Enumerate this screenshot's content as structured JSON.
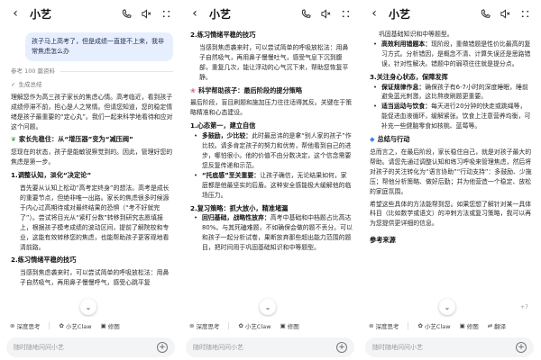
{
  "app": {
    "title": "小艺",
    "toolbar": [
      "深度思考",
      "小艺Claw",
      "修图",
      "翻译"
    ],
    "input_placeholder": "随时随地问问小艺"
  },
  "panel1": {
    "user_message": "孩子马上高考了，但是成绩一直提不上来，我非常焦虑怎么办",
    "ref_label": "参考 100 篇资料",
    "thinking_label": "生成总结",
    "intro": "理解您作为高三孩子家长的焦虑心情。高考临近，看到孩子成绩停滞不前，担心是人之常情。但请您知道，您的稳定情绪是孩子最重要的“定心丸”。我们一起来科学地看待和应对这个问题。",
    "section_title": "家长先稳住：从“增压器”变为“减压阀”",
    "section_intro": "您现在的状态，孩子是能敏锐察觉到的。因此，管理好您的焦虑是第一步。",
    "h1": "1.调整认知，淡化“决定论”",
    "h1_body": "首先要从认知上松动“高考定终身”的想法。高考是成长的重要节点，但绝非唯一出路。家长的焦虑很多时候源于内心过高期待或对最终结果的恐惧（“考不好就完了”）。尝试将目光从“紧盯分数”转移到研究志愿填报上，根据孩子模考成绩的波动区间，提前了解院校和专业，这能有效转移您的焦虑，也能帮助孩子更客观地看清前路。",
    "h2": "2.练习情绪平稳的技巧",
    "h2_body": "当感到焦虑袭来时，可以尝试简单的呼吸放松法：用鼻子自然吸气，再用鼻子慢慢呼气，感受心跳平复"
  },
  "panel2": {
    "h2": "2.练习情绪平稳的技巧",
    "h2_body": "当感到焦虑袭来时，可以尝试简单的呼吸放松法：用鼻子自然吸气，再用鼻子慢慢吐气，感受气息下沉到腹部，重复几次，能让浮动的心气沉下来，帮助您恢复平静。",
    "section_title": "科学帮助孩子：最后阶段的提分策略",
    "section_intro": "最后阶段，盲目刷题和施加压力往往适得其反。关键在于策略精准和心态建设。",
    "h1": "1.心态第一，建立自信",
    "b1_title": "多鼓励，少比较：",
    "b1_body": "此时最忌讳的是拿“别人家的孩子”作比较。请多肯定孩子的努力和优势，帮他看到自己的进步，哪怕很小。他的价值不由分数决定，这个信念需要您反复传递和示范。",
    "b2_title": "“托底感”至关重要：",
    "b2_body": "让孩子确信，无论结果如何，家庭都是他最坚实的后盾。这种安全感能极大缓解他的临场压力。",
    "h2b": "2.复习策略：抓大放小，精准堵漏",
    "b3_title": "回归基础，战略性放弃：",
    "b3_body": "高考中基础和中档题占比高达80%。与其死磕难题，不如确保会做的题不丢分。可以和孩子一起分析试卷，果断放弃那些超出能力范围的题目，把时间用于巩固基础知识和中等题型。"
  },
  "panel3": {
    "top_text": "巩固基础知识和中等题型。",
    "b1_title": "高效利用错题本：",
    "b1_body": "现阶段，重做错题是性价比最高的复习方式。分析错因，是概念不清、计算失误还是思路错误，针对性解决。错题中的弱项往往就是提分点。",
    "h3": "3.关注身心状态，保障发挥",
    "b2_title": "保证规律作息：",
    "b2_body": "确保孩子有6-7小时的深度睡眠，睡前避免蓝光刺激，这比熬夜刷题更重要。",
    "b3_title": "适当运动与饮食：",
    "b3_body": "每天进行20分钟的快走或跳绳等，能促进血液循环，缓解紧张。饮食上注意营养均衡，可补充一些健脑零食如核桃、蓝莓等。",
    "summary_title": "总结与行动",
    "summary_body": "总而言之，在最后阶段，家长稳住自己，就是对孩子最大的帮助。请您先通过调整认知和练习呼吸来管理焦虑，然后将对孩子的关注转化为“语言协助”“行动支持”：多鼓励、少施压；帮他分析策略、做好后勤；并为他营造一个稳定、放松的家庭氛围。",
    "closing": "希望这些具体的方法能帮到您。如果您想了解针对某一具体科目（比如数学或语文）的冲刺方法或复习策略，我可以再为您提供更详细的信息。",
    "ref_title": "参考来源",
    "ref_count": "+7"
  }
}
